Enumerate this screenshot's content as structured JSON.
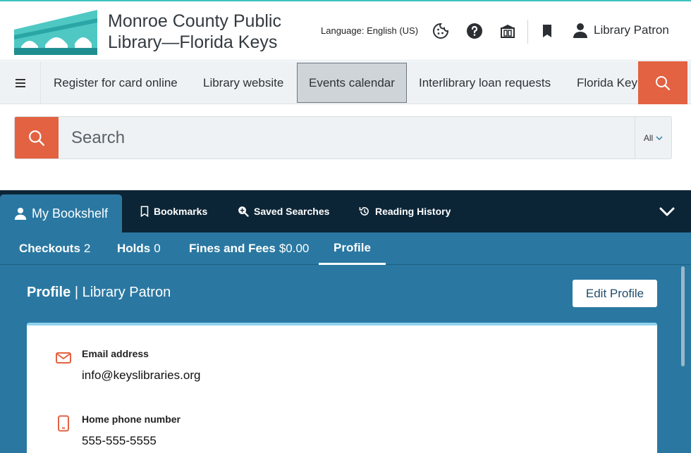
{
  "header": {
    "library_name": "Monroe County Public Library—Florida Keys",
    "language": "Language: English (US)",
    "patron_name": "Library Patron",
    "accent_color": "#3cc3c0",
    "icons": [
      "cookie-icon",
      "help-icon",
      "library-icon",
      "bookmark-icon",
      "user-icon"
    ]
  },
  "nav": {
    "items": [
      {
        "label": "Register for card online"
      },
      {
        "label": "Library website"
      },
      {
        "label": "Events calendar",
        "active": true
      },
      {
        "label": "Interlibrary loan requests"
      },
      {
        "label": "Florida Key"
      }
    ]
  },
  "search": {
    "placeholder": "Search",
    "scope": "All",
    "button_color": "#e36242"
  },
  "shelf_tabs": [
    {
      "label": "My Bookshelf",
      "icon": "user-icon",
      "active": true
    },
    {
      "label": "Bookmarks",
      "icon": "bookmark-icon"
    },
    {
      "label": "Saved Searches",
      "icon": "saved-search-icon"
    },
    {
      "label": "Reading History",
      "icon": "history-icon"
    }
  ],
  "sub_tabs": [
    {
      "label": "Checkouts",
      "count": "2"
    },
    {
      "label": "Holds",
      "count": "0"
    },
    {
      "label": "Fines and Fees",
      "count": "$0.00"
    },
    {
      "label": "Profile",
      "count": "",
      "active": true
    }
  ],
  "profile": {
    "title": "Profile",
    "separator": "|",
    "name": "Library Patron",
    "edit_label": "Edit Profile",
    "fields": [
      {
        "label": "Email address",
        "value": "info@keyslibraries.org",
        "icon": "email-icon"
      },
      {
        "label": "Home phone number",
        "value": "555-555-5555",
        "icon": "phone-icon"
      }
    ]
  },
  "colors": {
    "panel_blue": "#2a78a2",
    "dark_navy": "#0c2536",
    "accent_orange": "#e36242"
  }
}
